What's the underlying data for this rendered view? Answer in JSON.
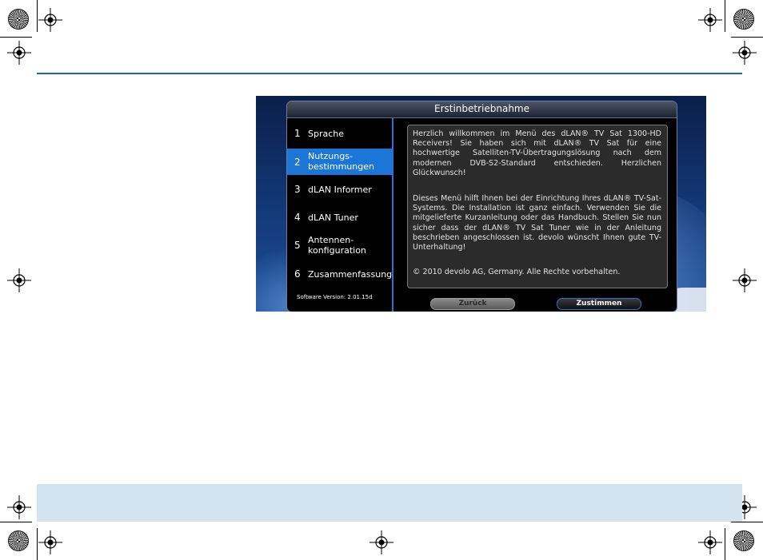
{
  "dialog": {
    "title": "Erstinbetriebnahme"
  },
  "sidebar": {
    "items": [
      {
        "num": "1",
        "label": "Sprache"
      },
      {
        "num": "2",
        "label": "Nutzungs-\nbestimmungen",
        "active": true
      },
      {
        "num": "3",
        "label": "dLAN Informer"
      },
      {
        "num": "4",
        "label": "dLAN Tuner"
      },
      {
        "num": "5",
        "label": "Antennen-\nkonfiguration"
      },
      {
        "num": "6",
        "label": "Zusammenfassung"
      }
    ],
    "software_version": "Software Version: 2.01.15d"
  },
  "content": {
    "paragraphs": [
      "Herzlich willkommen im Menü des dLAN® TV Sat 1300-HD Receivers! Sie haben sich mit dLAN® TV Sat für eine hochwertige Satelliten-TV-Übertragungslösung nach dem modernen DVB-S2-Standard entschieden. Herzlichen Glückwunsch!",
      "Dieses Menü hilft Ihnen bei der Einrichtung Ihres dLAN® TV-Sat-Systems. Die Installation ist ganz einfach. Verwenden Sie die mitgelieferte Kurzanleitung oder das Handbuch. Stellen Sie nun sicher dass der dLAN® TV Sat Tuner wie in der Anleitung beschrieben angeschlossen ist. devolo wünscht Ihnen gute TV-Unterhaltung!",
      "© 2010 devolo AG, Germany. Alle Rechte vorbehalten."
    ]
  },
  "buttons": {
    "back": "Zurück",
    "agree": "Zustimmen"
  },
  "colors": {
    "accent": "#1c76d8",
    "rule": "#1f5fbf",
    "band": "#d3e4f0"
  }
}
